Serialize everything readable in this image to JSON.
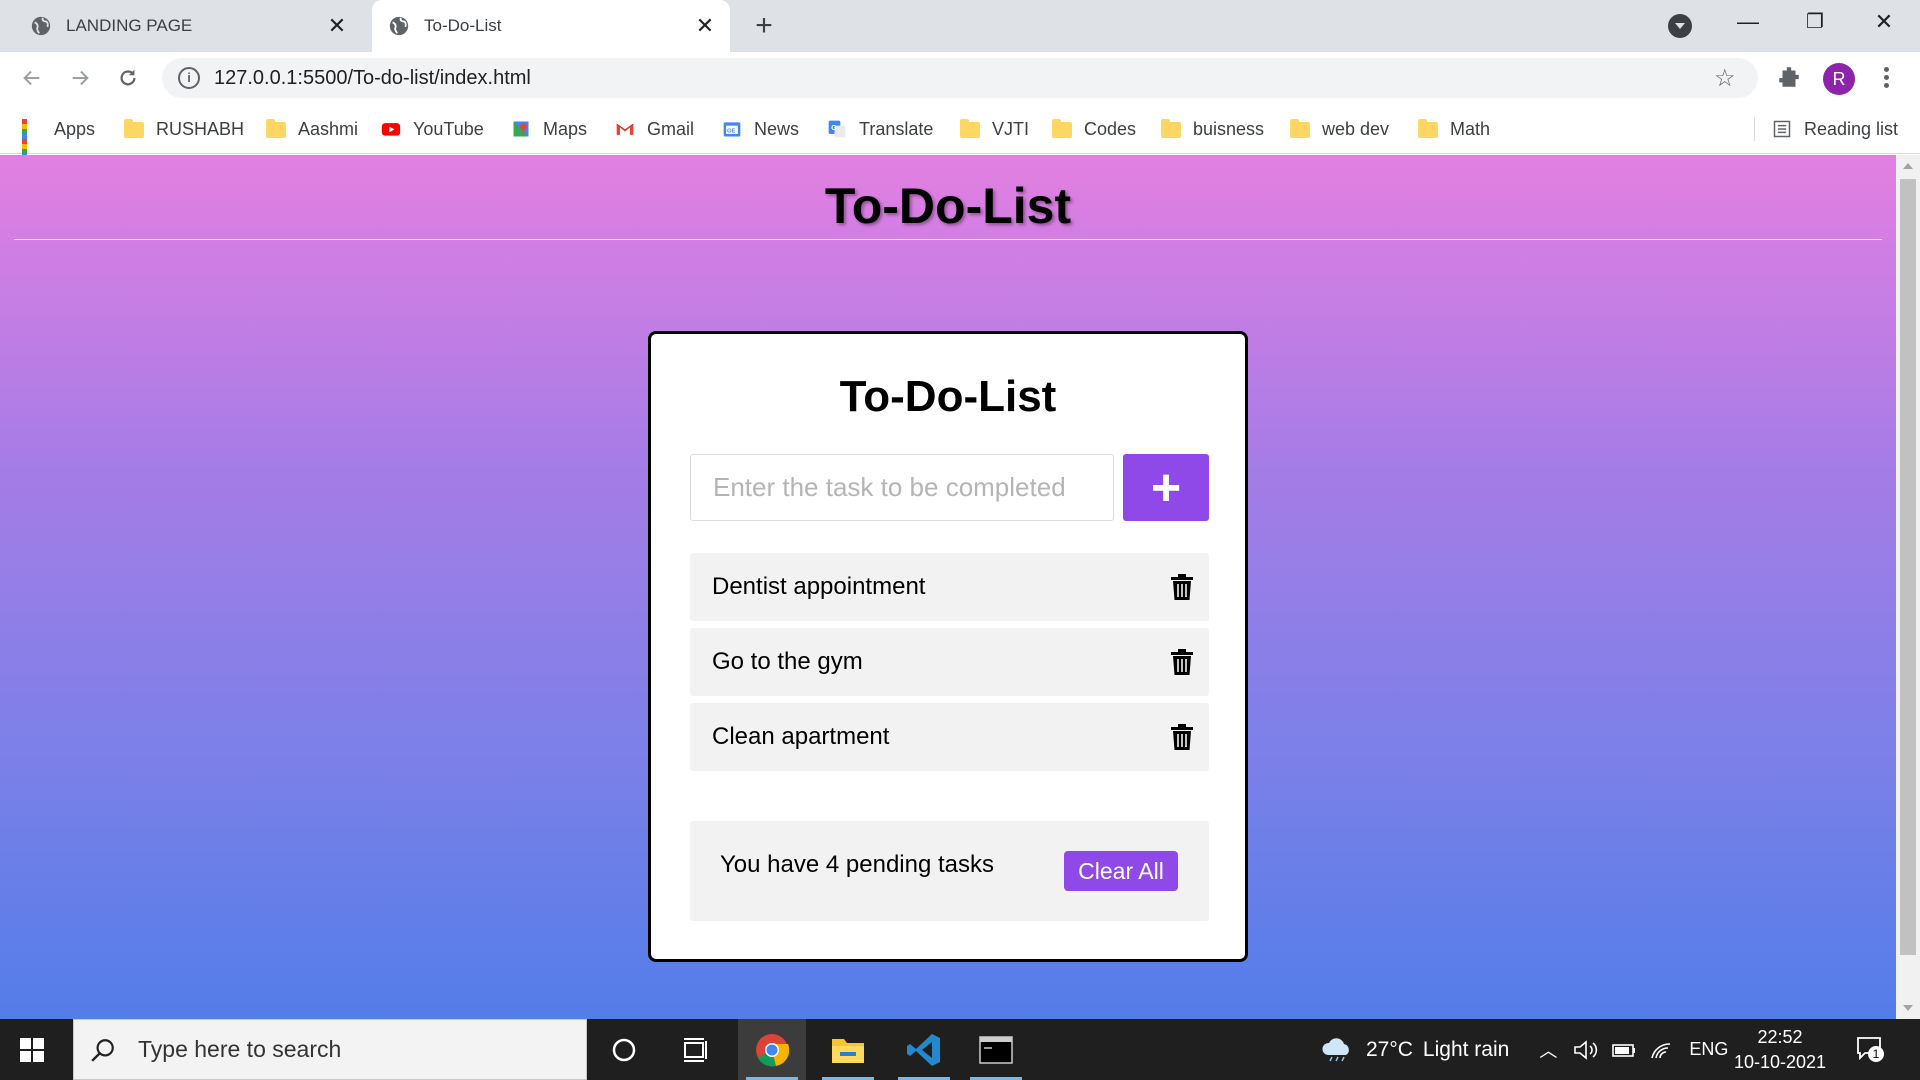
{
  "browser": {
    "tabs": [
      {
        "label": "LANDING PAGE",
        "active": false
      },
      {
        "label": "To-Do-List",
        "active": true
      }
    ],
    "new_tab": "+",
    "window": {
      "minimize": "—",
      "restore": "❐",
      "close": "✕"
    },
    "url": "127.0.0.1:5500/To-do-list/index.html",
    "profile_initial": "R",
    "bookmarks": [
      {
        "label": "Apps",
        "icon": "apps-grid-icon"
      },
      {
        "label": "RUSHABH",
        "icon": "folder-icon"
      },
      {
        "label": "Aashmi",
        "icon": "folder-icon"
      },
      {
        "label": "YouTube",
        "icon": "youtube-icon"
      },
      {
        "label": "Maps",
        "icon": "maps-icon"
      },
      {
        "label": "Gmail",
        "icon": "gmail-icon"
      },
      {
        "label": "News",
        "icon": "news-icon"
      },
      {
        "label": "Translate",
        "icon": "translate-icon"
      },
      {
        "label": "VJTI",
        "icon": "folder-icon"
      },
      {
        "label": "Codes",
        "icon": "folder-icon"
      },
      {
        "label": "buisness",
        "icon": "folder-icon"
      },
      {
        "label": "web dev",
        "icon": "folder-icon"
      },
      {
        "label": "Math",
        "icon": "folder-icon"
      }
    ],
    "reading_list": "Reading list"
  },
  "page": {
    "header_title": "To-Do-List",
    "card": {
      "title": "To-Do-List",
      "input_placeholder": "Enter the task to be completed",
      "add_label": "+",
      "tasks": [
        "Dentist appointment",
        "Go to the gym",
        "Clean apartment"
      ],
      "pending_text": "You have 4 pending tasks",
      "clear_label": "Clear All"
    },
    "colors": {
      "accent": "#8e49e8",
      "gradient_top": "#e37fe2",
      "gradient_bottom": "#537de9"
    }
  },
  "taskbar": {
    "search_placeholder": "Type here to search",
    "weather_temp": "27°C",
    "weather_desc": "Light rain",
    "language": "ENG",
    "time": "22:52",
    "date": "10-10-2021",
    "notification_count": "1"
  }
}
